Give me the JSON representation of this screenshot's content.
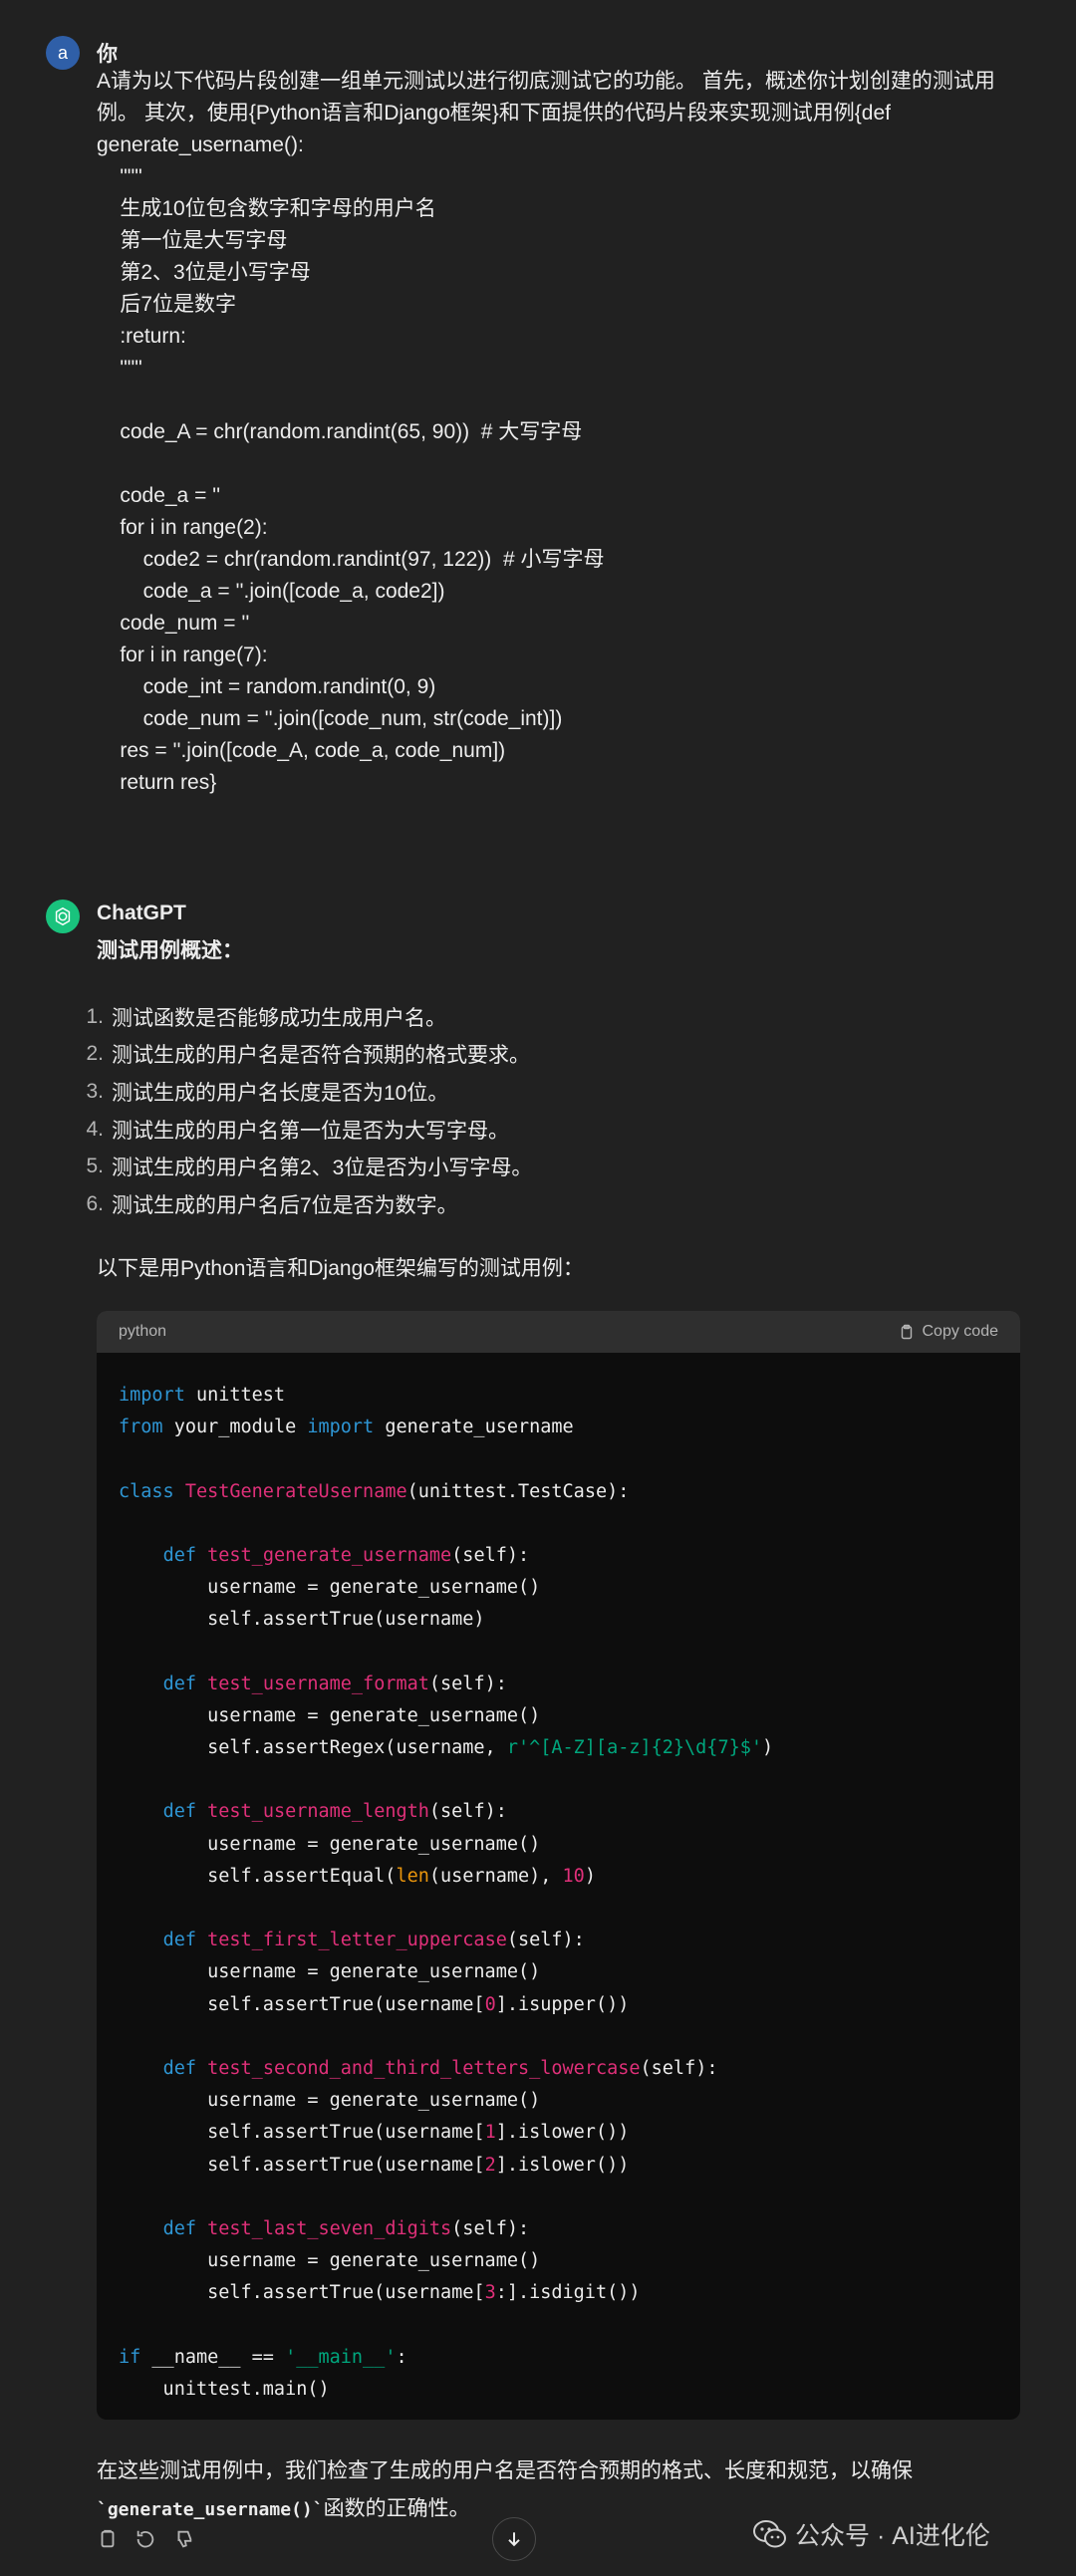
{
  "user": {
    "avatar_letter": "a",
    "name": "你",
    "message_lines": [
      "A请为以下代码片段创建一组单元测试以进行彻底测试它的功能。 首先，概述你计划创建的测试用",
      "例。 其次，使用{Python语言和Django框架}和下面提供的代码片段来实现测试用例{def",
      "generate_username():",
      "    \"\"\"",
      "    生成10位包含数字和字母的用户名",
      "    第一位是大写字母",
      "    第2、3位是小写字母",
      "    后7位是数字",
      "    :return:",
      "    \"\"\"",
      "",
      "    code_A = chr(random.randint(65, 90))  # 大写字母",
      "",
      "    code_a = ''",
      "    for i in range(2):",
      "        code2 = chr(random.randint(97, 122))  # 小写字母",
      "        code_a = ''.join([code_a, code2])",
      "    code_num = ''",
      "    for i in range(7):",
      "        code_int = random.randint(0, 9)",
      "        code_num = ''.join([code_num, str(code_int)])",
      "    res = ''.join([code_A, code_a, code_num])",
      "    return res}"
    ]
  },
  "assistant": {
    "name": "ChatGPT",
    "heading": "测试用例概述：",
    "cases": [
      {
        "num": "1.",
        "text": "测试函数是否能够成功生成用户名。"
      },
      {
        "num": "2.",
        "text": "测试生成的用户名是否符合预期的格式要求。"
      },
      {
        "num": "3.",
        "text": "测试生成的用户名长度是否为10位。"
      },
      {
        "num": "4.",
        "text": "测试生成的用户名第一位是否为大写字母。"
      },
      {
        "num": "5.",
        "text": "测试生成的用户名第2、3位是否为小写字母。"
      },
      {
        "num": "6.",
        "text": "测试生成的用户名后7位是否为数字。"
      }
    ],
    "intro": "以下是用Python语言和Django框架编写的测试用例：",
    "code_language": "python",
    "copy_label": "Copy code",
    "code_tokens": [
      [
        [
          "kw",
          "import"
        ],
        [
          "p",
          " unittest"
        ]
      ],
      [
        [
          "kw",
          "from"
        ],
        [
          "p",
          " your_module "
        ],
        [
          "kw",
          "import"
        ],
        [
          "p",
          " generate_username"
        ]
      ],
      [],
      [
        [
          "kw",
          "class"
        ],
        [
          "p",
          " "
        ],
        [
          "fn",
          "TestGenerateUsername"
        ],
        [
          "p",
          "(unittest.TestCase):"
        ]
      ],
      [],
      [
        [
          "p",
          "    "
        ],
        [
          "kw",
          "def"
        ],
        [
          "p",
          " "
        ],
        [
          "fn",
          "test_generate_username"
        ],
        [
          "p",
          "(self):"
        ]
      ],
      [
        [
          "p",
          "        username = generate_username()"
        ]
      ],
      [
        [
          "p",
          "        self.assertTrue(username)"
        ]
      ],
      [],
      [
        [
          "p",
          "    "
        ],
        [
          "kw",
          "def"
        ],
        [
          "p",
          " "
        ],
        [
          "fn",
          "test_username_format"
        ],
        [
          "p",
          "(self):"
        ]
      ],
      [
        [
          "p",
          "        username = generate_username()"
        ]
      ],
      [
        [
          "p",
          "        self.assertRegex(username, "
        ],
        [
          "str",
          "r'^[A-Z][a-z]{2}\\d{7}$'"
        ],
        [
          "p",
          ")"
        ]
      ],
      [],
      [
        [
          "p",
          "    "
        ],
        [
          "kw",
          "def"
        ],
        [
          "p",
          " "
        ],
        [
          "fn",
          "test_username_length"
        ],
        [
          "p",
          "(self):"
        ]
      ],
      [
        [
          "p",
          "        username = generate_username()"
        ]
      ],
      [
        [
          "p",
          "        self.assertEqual("
        ],
        [
          "bi",
          "len"
        ],
        [
          "p",
          "(username), "
        ],
        [
          "num",
          "10"
        ],
        [
          "p",
          ")"
        ]
      ],
      [],
      [
        [
          "p",
          "    "
        ],
        [
          "kw",
          "def"
        ],
        [
          "p",
          " "
        ],
        [
          "fn",
          "test_first_letter_uppercase"
        ],
        [
          "p",
          "(self):"
        ]
      ],
      [
        [
          "p",
          "        username = generate_username()"
        ]
      ],
      [
        [
          "p",
          "        self.assertTrue(username["
        ],
        [
          "num",
          "0"
        ],
        [
          "p",
          "].isupper())"
        ]
      ],
      [],
      [
        [
          "p",
          "    "
        ],
        [
          "kw",
          "def"
        ],
        [
          "p",
          " "
        ],
        [
          "fn",
          "test_second_and_third_letters_lowercase"
        ],
        [
          "p",
          "(self):"
        ]
      ],
      [
        [
          "p",
          "        username = generate_username()"
        ]
      ],
      [
        [
          "p",
          "        self.assertTrue(username["
        ],
        [
          "num",
          "1"
        ],
        [
          "p",
          "].islower())"
        ]
      ],
      [
        [
          "p",
          "        self.assertTrue(username["
        ],
        [
          "num",
          "2"
        ],
        [
          "p",
          "].islower())"
        ]
      ],
      [],
      [
        [
          "p",
          "    "
        ],
        [
          "kw",
          "def"
        ],
        [
          "p",
          " "
        ],
        [
          "fn",
          "test_last_seven_digits"
        ],
        [
          "p",
          "(self):"
        ]
      ],
      [
        [
          "p",
          "        username = generate_username()"
        ]
      ],
      [
        [
          "p",
          "        self.assertTrue(username["
        ],
        [
          "num",
          "3"
        ],
        [
          "p",
          ":].isdigit())"
        ]
      ],
      [],
      [
        [
          "kw",
          "if"
        ],
        [
          "p",
          " __name__ == "
        ],
        [
          "str",
          "'__main__'"
        ],
        [
          "p",
          ":"
        ]
      ],
      [
        [
          "p",
          "    unittest.main()"
        ]
      ]
    ],
    "closing_before": "在这些测试用例中，我们检查了生成的用户名是否符合预期的格式、长度和规范，以确保",
    "closing_code": "`generate_username()`",
    "closing_after": "函数的正确性。"
  },
  "watermark": "公众号 · AI进化伦"
}
